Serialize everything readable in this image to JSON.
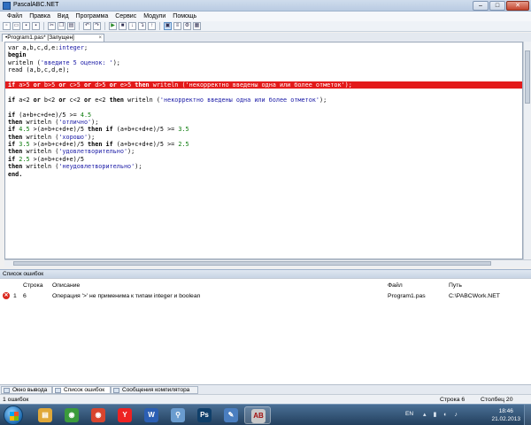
{
  "window": {
    "title": "PascalABC.NET"
  },
  "menu": [
    "Файл",
    "Правка",
    "Вид",
    "Программа",
    "Сервис",
    "Модули",
    "Помощь"
  ],
  "document_tab": {
    "label": "•Program1.pas* [Запущен]",
    "close": "×"
  },
  "code": [
    [
      [
        "var a,b,c,d,e:",
        ""
      ],
      [
        "integer",
        "type"
      ],
      [
        ";",
        ""
      ]
    ],
    [
      [
        "begin",
        "kw"
      ]
    ],
    [
      [
        "writeln (",
        ""
      ],
      [
        "'введите 5 оценок: '",
        "str"
      ],
      [
        ");",
        ""
      ]
    ],
    [
      [
        "read (a,b,c,d,e);",
        ""
      ]
    ],
    [],
    [
      [
        "if",
        "kw"
      ],
      [
        " a>5 ",
        ""
      ],
      [
        "or",
        "kw"
      ],
      [
        " b>5 ",
        ""
      ],
      [
        "or",
        "kw"
      ],
      [
        " c>5 ",
        ""
      ],
      [
        "or",
        "kw"
      ],
      [
        " d>5 ",
        ""
      ],
      [
        "or",
        "kw"
      ],
      [
        " e>5 ",
        ""
      ],
      [
        "then",
        "kw"
      ],
      [
        " writeln (",
        ""
      ],
      [
        "'некорректно введены одна или более отметок'",
        "str"
      ],
      [
        ");",
        ""
      ]
    ],
    [],
    [
      [
        "if",
        "kw"
      ],
      [
        " a<2 ",
        ""
      ],
      [
        "or",
        "kw"
      ],
      [
        " b<2 ",
        ""
      ],
      [
        "or",
        "kw"
      ],
      [
        " c<2 ",
        ""
      ],
      [
        "or",
        "kw"
      ],
      [
        " e<2 ",
        ""
      ],
      [
        "then",
        "kw"
      ],
      [
        " writeln (",
        ""
      ],
      [
        "'некорректно введены одна или более отметок'",
        "str"
      ],
      [
        ");",
        ""
      ]
    ],
    [],
    [
      [
        "if",
        "kw"
      ],
      [
        " (a+b+c+d+e)/5 >= ",
        ""
      ],
      [
        "4.5",
        "num"
      ]
    ],
    [
      [
        "then",
        "kw"
      ],
      [
        " writeln (",
        ""
      ],
      [
        "'отлично'",
        "str"
      ],
      [
        ");",
        ""
      ]
    ],
    [
      [
        "if",
        "kw"
      ],
      [
        " ",
        ""
      ],
      [
        "4.5",
        "num"
      ],
      [
        " >(a+b+c+d+e)/5 ",
        ""
      ],
      [
        "then",
        "kw"
      ],
      [
        " ",
        ""
      ],
      [
        "if",
        "kw"
      ],
      [
        " (a+b+c+d+e)/5 >= ",
        ""
      ],
      [
        "3.5",
        "num"
      ]
    ],
    [
      [
        "then",
        "kw"
      ],
      [
        " writeln (",
        ""
      ],
      [
        "'хорошо'",
        "str"
      ],
      [
        ");",
        ""
      ]
    ],
    [
      [
        "if",
        "kw"
      ],
      [
        " ",
        ""
      ],
      [
        "3.5",
        "num"
      ],
      [
        " >(a+b+c+d+e)/5 ",
        ""
      ],
      [
        "then",
        "kw"
      ],
      [
        " ",
        ""
      ],
      [
        "if",
        "kw"
      ],
      [
        " (a+b+c+d+e)/5 >= ",
        ""
      ],
      [
        "2.5",
        "num"
      ]
    ],
    [
      [
        "then",
        "kw"
      ],
      [
        " writeln (",
        ""
      ],
      [
        "'удовлетворительно'",
        "str"
      ],
      [
        ");",
        ""
      ]
    ],
    [
      [
        "if",
        "kw"
      ],
      [
        " ",
        ""
      ],
      [
        "2.5",
        "num"
      ],
      [
        " >(a+b+c+d+e)/5",
        ""
      ]
    ],
    [
      [
        "then",
        "kw"
      ],
      [
        " writeln (",
        ""
      ],
      [
        "'неудовлетворительно'",
        "str"
      ],
      [
        ");",
        ""
      ]
    ],
    [
      [
        "end.",
        "kw"
      ]
    ]
  ],
  "error_line_index": 5,
  "error_panel": {
    "title": "Список ошибок",
    "headers": {
      "line": "Строка",
      "description": "Описание",
      "file": "Файл",
      "path": "Путь"
    },
    "rows": [
      {
        "icon": "error-icon",
        "num": "1",
        "line": "6",
        "description": "Операция '>' не применима к типам integer и boolean",
        "file": "Program1.pas",
        "path": "C:\\PABCWork.NET"
      }
    ]
  },
  "bottom_tabs": [
    "Окно вывода",
    "Список ошибок",
    "Сообщения компилятора"
  ],
  "status": {
    "errors": "1 ошибок",
    "row_label": "Строка  6",
    "col_label": "Столбец  20"
  },
  "taskbar": {
    "lang": "EN",
    "time": "18:46",
    "date": "21.02.2013",
    "apps": [
      {
        "name": "explorer-icon",
        "glyph": "▤",
        "color": "#e0a838"
      },
      {
        "name": "chrome-icon",
        "glyph": "◉",
        "color": "#3b9b3b"
      },
      {
        "name": "chrome-alt-icon",
        "glyph": "◉",
        "color": "#d8452e"
      },
      {
        "name": "yandex-icon",
        "glyph": "Y",
        "color": "#e22"
      },
      {
        "name": "word-icon",
        "glyph": "W",
        "color": "#2b5fb4"
      },
      {
        "name": "network-tool-icon",
        "glyph": "⚲",
        "color": "#6a9ccf"
      },
      {
        "name": "photoshop-icon",
        "glyph": "Ps",
        "color": "#0f3f6a"
      },
      {
        "name": "paint-icon",
        "glyph": "✎",
        "color": "#4a7ec0"
      },
      {
        "name": "pascalabc-icon",
        "glyph": "AB",
        "color": "#c9c9c9"
      }
    ]
  }
}
